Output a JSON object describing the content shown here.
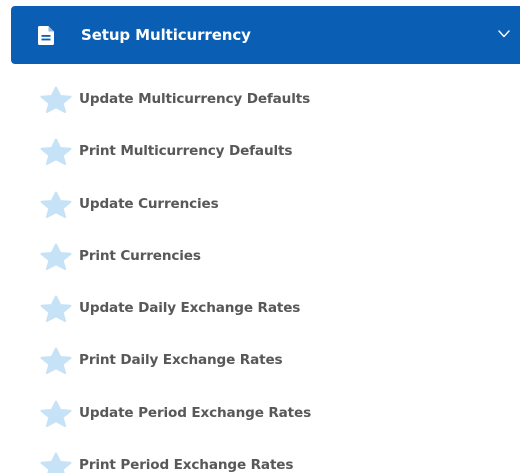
{
  "header": {
    "title": "Setup Multicurrency",
    "icon": "document-icon",
    "chevron": "chevron-down-icon",
    "background_color": "#0a5fb4",
    "text_color": "#ffffff"
  },
  "items": [
    {
      "label": "Update Multicurrency Defaults",
      "icon": "star-icon"
    },
    {
      "label": "Print Multicurrency Defaults",
      "icon": "star-icon"
    },
    {
      "label": "Update Currencies",
      "icon": "star-icon"
    },
    {
      "label": "Print Currencies",
      "icon": "star-icon"
    },
    {
      "label": "Update Daily Exchange Rates",
      "icon": "star-icon"
    },
    {
      "label": "Print Daily Exchange Rates",
      "icon": "star-icon"
    },
    {
      "label": "Update Period Exchange Rates",
      "icon": "star-icon"
    },
    {
      "label": "Print Period Exchange Rates",
      "icon": "star-icon"
    }
  ],
  "colors": {
    "item_text": "#58585a",
    "star_fill": "#c6e2f7"
  }
}
